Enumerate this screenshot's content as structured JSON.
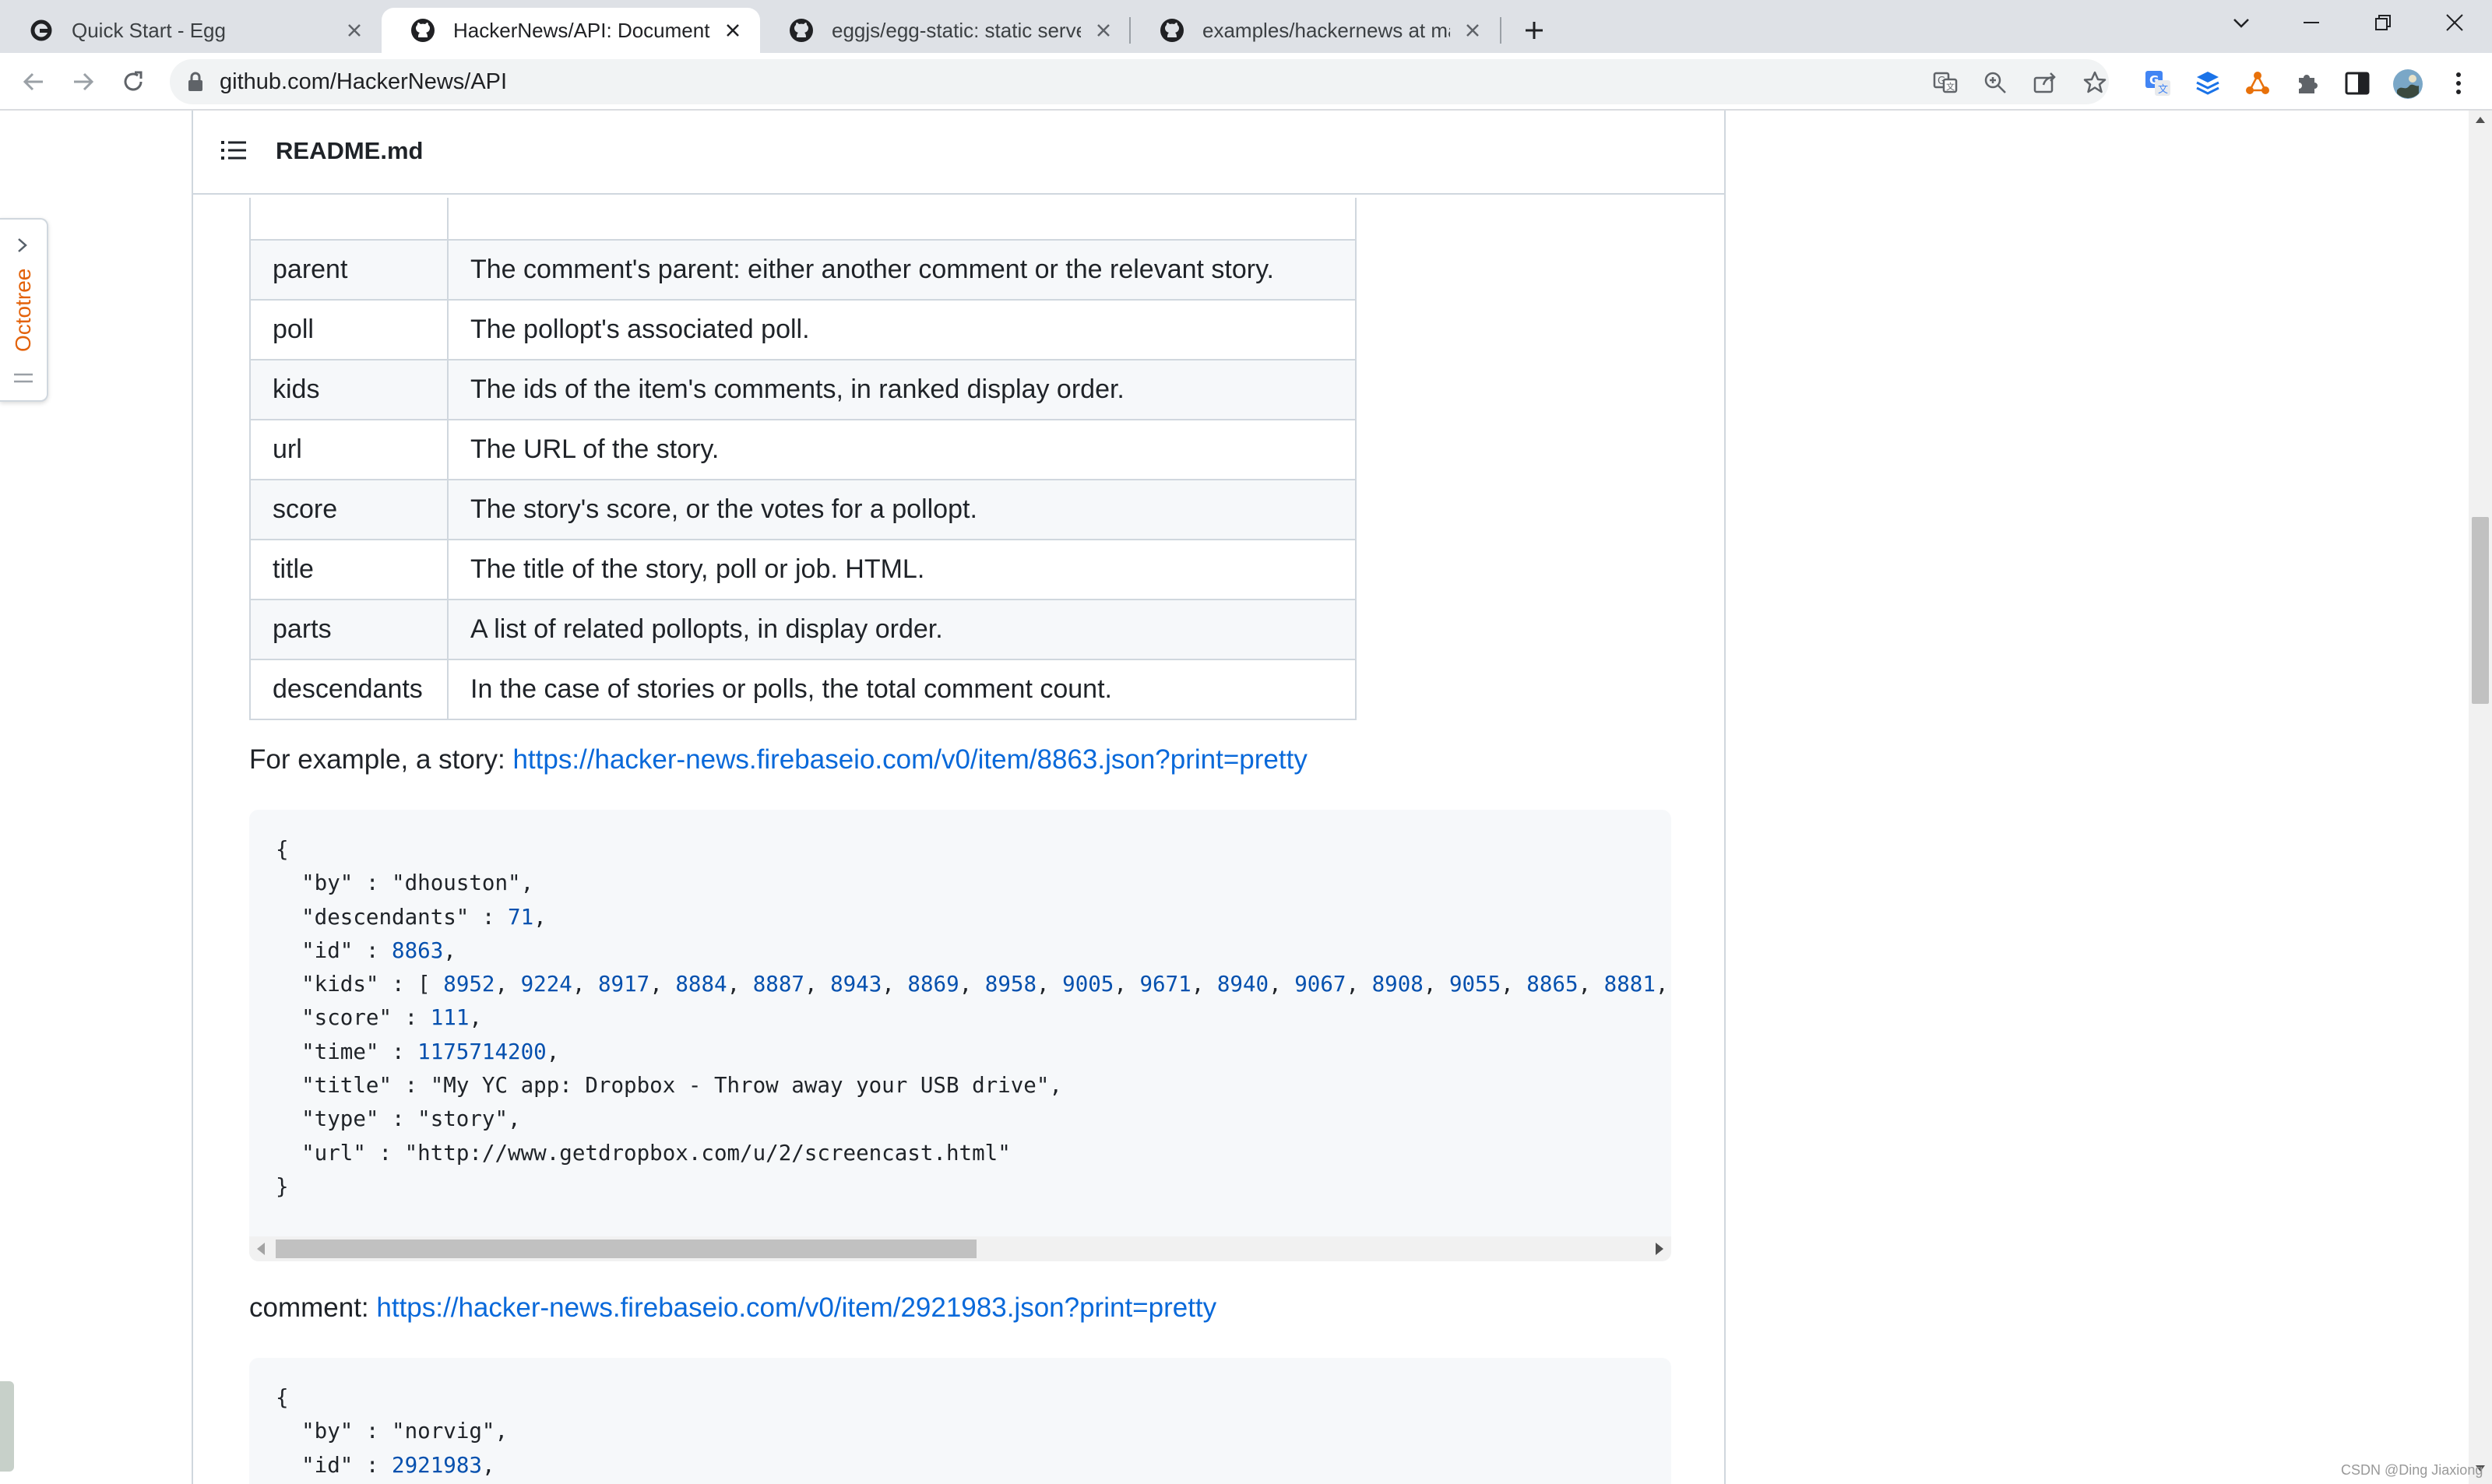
{
  "tabs": [
    {
      "title": "Quick Start - Egg",
      "icon": "egg-icon",
      "active": false
    },
    {
      "title": "HackerNews/API: Documentation",
      "icon": "github-icon",
      "active": true
    },
    {
      "title": "eggjs/egg-static: static server",
      "icon": "github-icon",
      "active": false
    },
    {
      "title": "examples/hackernews at master",
      "icon": "github-icon",
      "active": false
    }
  ],
  "address_bar": {
    "url": "github.com/HackerNews/API"
  },
  "readme": {
    "filename": "README.md"
  },
  "octotree": {
    "label": "Octotree"
  },
  "fields_table": [
    {
      "name": "parent",
      "desc": "The comment's parent: either another comment or the relevant story."
    },
    {
      "name": "poll",
      "desc": "The pollopt's associated poll."
    },
    {
      "name": "kids",
      "desc": "The ids of the item's comments, in ranked display order."
    },
    {
      "name": "url",
      "desc": "The URL of the story."
    },
    {
      "name": "score",
      "desc": "The story's score, or the votes for a pollopt."
    },
    {
      "name": "title",
      "desc": "The title of the story, poll or job. HTML."
    },
    {
      "name": "parts",
      "desc": "A list of related pollopts, in display order."
    },
    {
      "name": "descendants",
      "desc": "In the case of stories or polls, the total comment count."
    }
  ],
  "story_example": {
    "prefix": "For example, a story: ",
    "link": "https://hacker-news.firebaseio.com/v0/item/8863.json?print=pretty",
    "code": [
      "{",
      "  \"by\" : \"dhouston\",",
      "  \"descendants\" : 71,",
      "  \"id\" : 8863,",
      "  \"kids\" : [ 8952, 9224, 8917, 8884, 8887, 8943, 8869, 8958, 9005, 9671, 8940, 9067, 8908, 9055, 8865, 8881,",
      "  \"score\" : 111,",
      "  \"time\" : 1175714200,",
      "  \"title\" : \"My YC app: Dropbox - Throw away your USB drive\",",
      "  \"type\" : \"story\",",
      "  \"url\" : \"http://www.getdropbox.com/u/2/screencast.html\"",
      "}"
    ]
  },
  "comment_example": {
    "prefix": "comment: ",
    "link": "https://hacker-news.firebaseio.com/v0/item/2921983.json?print=pretty",
    "code": [
      "{",
      "  \"by\" : \"norvig\",",
      "  \"id\" : 2921983,"
    ]
  },
  "watermark": "CSDN @Ding Jiaxiong",
  "colors": {
    "link": "#0969da",
    "octotree": "#e36209",
    "tabstrip": "#dee1e6"
  }
}
